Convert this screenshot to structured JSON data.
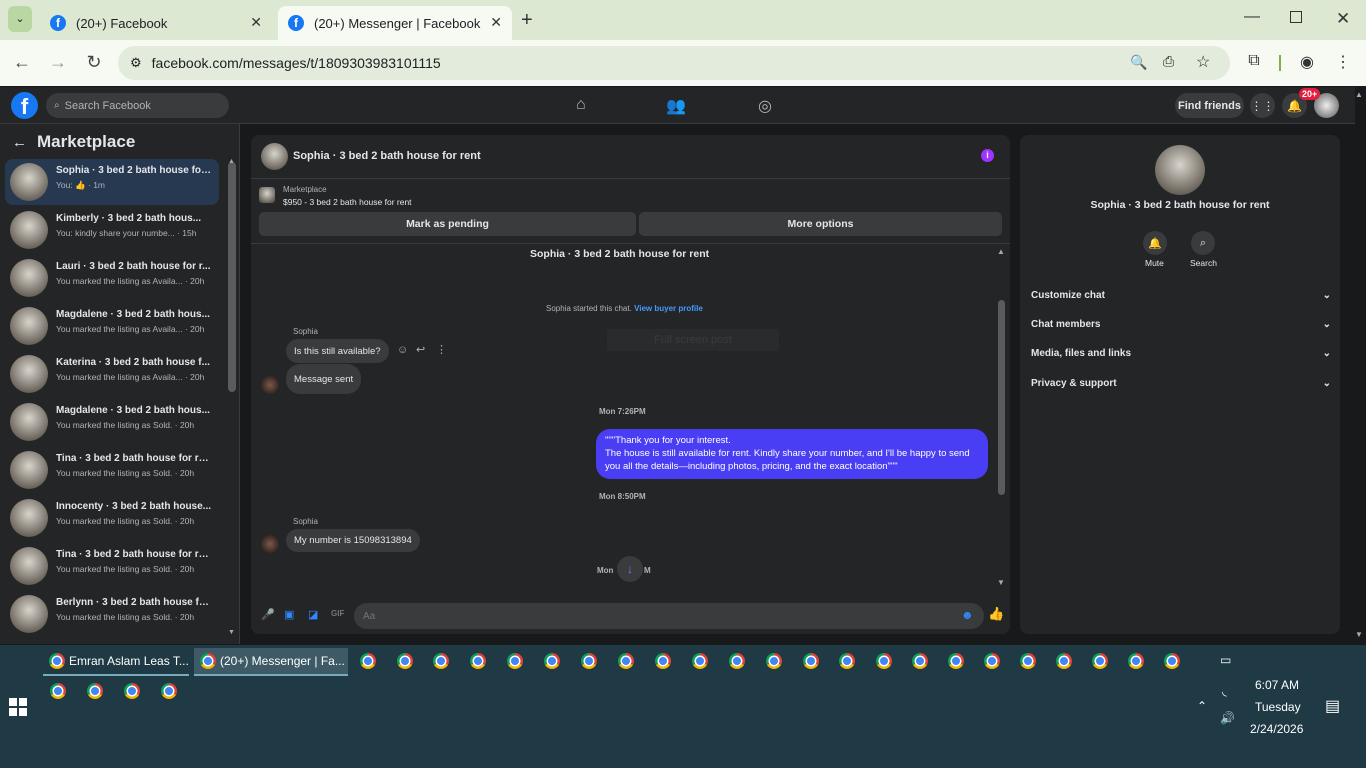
{
  "browser": {
    "tabs": [
      {
        "label": "(20+) Facebook",
        "active": false
      },
      {
        "label": "(20+) Messenger | Facebook",
        "active": true
      }
    ],
    "url": "facebook.com/messages/t/1809303983101115"
  },
  "fb": {
    "search_placeholder": "Search Facebook",
    "find_friends": "Find friends",
    "notif_badge": "20+"
  },
  "left": {
    "title": "Marketplace",
    "conversations": [
      {
        "title": "Sophia · 3 bed 2 bath house for...",
        "snippet": "You: 👍 · 1m"
      },
      {
        "title": "Kimberly · 3 bed 2 bath hous...",
        "snippet": "You: kindly share your numbe... · 15h"
      },
      {
        "title": "Lauri · 3 bed 2 bath house for r...",
        "snippet": "You marked the listing as Availa... · 20h"
      },
      {
        "title": "Magdalene · 3 bed 2 bath hous...",
        "snippet": "You marked the listing as Availa... · 20h"
      },
      {
        "title": "Katerina · 3 bed 2 bath house f...",
        "snippet": "You marked the listing as Availa... · 20h"
      },
      {
        "title": "Magdalene · 3 bed 2 bath hous...",
        "snippet": "You marked the listing as Sold. · 20h"
      },
      {
        "title": "Tina · 3 bed 2 bath house for re...",
        "snippet": "You marked the listing as Sold. · 20h"
      },
      {
        "title": "Innocenty · 3 bed 2 bath house...",
        "snippet": "You marked the listing as Sold. · 20h"
      },
      {
        "title": "Tina · 3 bed 2 bath house for re...",
        "snippet": "You marked the listing as Sold. · 20h"
      },
      {
        "title": "Berlynn · 3 bed 2 bath house fo...",
        "snippet": "You marked the listing as Sold. · 20h"
      }
    ]
  },
  "chat": {
    "title": "Sophia · 3 bed 2 bath house for rent",
    "listing_label": "Marketplace",
    "listing_text": "$950 - 3 bed 2 bath house for rent",
    "mark_pending": "Mark as pending",
    "more_options": "More options",
    "thread_title": "Sophia · 3 bed 2 bath house for rent",
    "started_text": "Sophia started this chat.",
    "view_buyer": "View buyer profile",
    "faded_text": "Full screen post",
    "sender1": "Sophia",
    "msg1": "Is this still available?",
    "msg2": "Message sent",
    "ts1": "Mon 7:26PM",
    "out_line1": "\"\"\"Thank you for your interest.",
    "out_line2": "The house is still available for rent. Kindly share your number, and I'll be happy to send you all the details—including photos, pricing, and the exact location\"\"\"",
    "ts2": "Mon 8:50PM",
    "sender2": "Sophia",
    "msg3": "My number is 15098313894",
    "ts3": "Mon",
    "ts3b": "M",
    "input_placeholder": "Aa"
  },
  "right": {
    "title": "Sophia · 3 bed 2 bath house for rent",
    "mute": "Mute",
    "search": "Search",
    "sections": [
      "Customize chat",
      "Chat members",
      "Media, files and links",
      "Privacy & support"
    ]
  },
  "taskbar": {
    "app1": "Emran Aslam Leas T...",
    "app2": "(20+) Messenger | Fa...",
    "time": "6:07 AM",
    "day": "Tuesday",
    "date": "2/24/2026"
  },
  "colors": {
    "accent": "#1877f2",
    "outgoing": "#4a3ef5",
    "bg": "#18191a",
    "panel": "#242526"
  }
}
